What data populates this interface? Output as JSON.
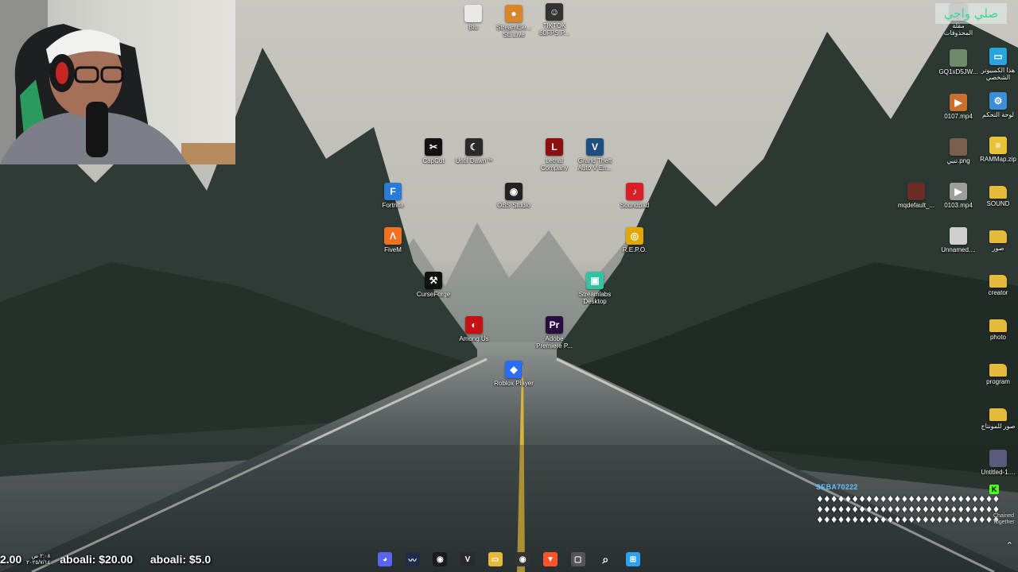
{
  "overlay": {
    "arabic_text": "صلي واجي"
  },
  "chat": {
    "username": "SEBA70222",
    "message": "♦♦♦♦♦♦♦♦♦♦♦♦♦♦♦♦♦♦♦♦♦♦♦♦♦♦♦♦♦♦♦♦♦♦♦♦♦♦♦♦♦♦♦♦♦♦♦♦♦♦♦♦♦♦♦♦♦♦♦♦♦♦♦♦♦♦♦♦♦♦♦♦♦♦♦♦♦♦",
    "badge": "K",
    "side_note": "Chained\nTogether"
  },
  "ticker": {
    "clock_time": "٢:٠٨ ص",
    "clock_date": "٢٠٢٥/٧/١٤",
    "entries": [
      {
        "amount": "2.00",
        "name": "aboali:",
        "value": "$20.00"
      },
      {
        "name": "aboali:",
        "value": "$5.0"
      }
    ]
  },
  "desktop_icons": [
    {
      "id": "blu",
      "label": "Blu",
      "color": "#e8e8e8",
      "glyph": ""
    },
    {
      "id": "streamelements",
      "label": "StreamEle...\nSE.Live",
      "color": "#d9862b",
      "glyph": "●"
    },
    {
      "id": "tiktok",
      "label": "TIKTOK\n60FPS P...",
      "color": "#333",
      "glyph": "☺"
    },
    {
      "id": "capcut",
      "label": "CapCut",
      "color": "#111",
      "glyph": "✂"
    },
    {
      "id": "until-dawn",
      "label": "Until Dawn™",
      "color": "#2a2a2a",
      "glyph": "☾"
    },
    {
      "id": "lethal-company",
      "label": "Lethal\nCompany",
      "color": "#8b1010",
      "glyph": "L"
    },
    {
      "id": "gta",
      "label": "Grand Theft\nAuto V En...",
      "color": "#1d4f80",
      "glyph": "V"
    },
    {
      "id": "fortnite",
      "label": "Fortnite",
      "color": "#2a7ad8",
      "glyph": "F"
    },
    {
      "id": "obs",
      "label": "OBS Studio",
      "color": "#222",
      "glyph": "◉"
    },
    {
      "id": "soundpad",
      "label": "Soundpad",
      "color": "#d91f26",
      "glyph": "♪"
    },
    {
      "id": "fivem",
      "label": "FiveM",
      "color": "#f27121",
      "glyph": "Λ"
    },
    {
      "id": "repo",
      "label": "R.E.P.O.",
      "color": "#e0a800",
      "glyph": "◎"
    },
    {
      "id": "curseforge",
      "label": "CurseForge",
      "color": "#111",
      "glyph": "⚒"
    },
    {
      "id": "streamlabs",
      "label": "Streamlabs\nDesktop",
      "color": "#31c3a2",
      "glyph": "▣"
    },
    {
      "id": "among-us",
      "label": "Among Us",
      "color": "#c51111",
      "glyph": "◐"
    },
    {
      "id": "premiere",
      "label": "Adobe\nPremiere P...",
      "color": "#2a0b3f",
      "glyph": "Pr"
    },
    {
      "id": "roblox",
      "label": "Roblox Player",
      "color": "#2b6df2",
      "glyph": "◆"
    },
    {
      "id": "png-top",
      "label": "مقلة\nالمحذوفات",
      "color": "#9fa3a5",
      "glyph": ""
    },
    {
      "id": "this-pc",
      "label": "هذا الكمبيوتر\nالشخصي",
      "color": "#2aa4e0",
      "glyph": "▭"
    },
    {
      "id": "gq-img",
      "label": "GQ1xD5JW...",
      "color": "#6d8a6a",
      "glyph": ""
    },
    {
      "id": "control-panel",
      "label": "لوحة التحكم",
      "color": "#3b8fd8",
      "glyph": "⚙"
    },
    {
      "id": "mp4-0107",
      "label": "0107.mp4",
      "color": "#c9702f",
      "glyph": "▶"
    },
    {
      "id": "png-2",
      "label": "تنبي.png",
      "color": "#7a5f4c",
      "glyph": ""
    },
    {
      "id": "rammap",
      "label": "RAMMap.zip",
      "color": "#e9c23a",
      "glyph": "≡"
    },
    {
      "id": "mqdefault",
      "label": "mqdefault_...",
      "color": "#6b2c25",
      "glyph": ""
    },
    {
      "id": "mp4-0103",
      "label": "0103.mp4",
      "color": "#9d9d9d",
      "glyph": "▶"
    },
    {
      "id": "sound",
      "label": "SOUND",
      "color": "#e6b93a",
      "glyph": ""
    },
    {
      "id": "unnamed",
      "label": "Unnamed....",
      "color": "#cfcfcf",
      "glyph": ""
    },
    {
      "id": "folder-images",
      "label": "صور",
      "color": "#e6b93a",
      "glyph": ""
    },
    {
      "id": "creator",
      "label": "creator",
      "color": "#e6b93a",
      "glyph": ""
    },
    {
      "id": "photo",
      "label": "photo",
      "color": "#e6b93a",
      "glyph": ""
    },
    {
      "id": "program",
      "label": "program",
      "color": "#e6b93a",
      "glyph": ""
    },
    {
      "id": "montage",
      "label": "صور للمونتاج",
      "color": "#e6b93a",
      "glyph": ""
    },
    {
      "id": "untitled",
      "label": "Untitled-1....",
      "color": "#5a5a7a",
      "glyph": ""
    }
  ],
  "taskbar": [
    {
      "id": "discord",
      "color": "#5865f2",
      "glyph": "◕"
    },
    {
      "id": "streamerbot",
      "color": "#1e2b4a",
      "glyph": "〰"
    },
    {
      "id": "chrome-like",
      "color": "#1a1a1a",
      "glyph": "◉"
    },
    {
      "id": "voicemeeter",
      "color": "#2b2b2b",
      "glyph": "V"
    },
    {
      "id": "file-explorer",
      "color": "#e6b93a",
      "glyph": "▭"
    },
    {
      "id": "obs",
      "color": "#333",
      "glyph": "◉"
    },
    {
      "id": "brave",
      "color": "#fb542b",
      "glyph": "▼"
    },
    {
      "id": "task-view",
      "color": "#555",
      "glyph": "▢"
    },
    {
      "id": "search",
      "color": "transparent",
      "glyph": "⌕"
    },
    {
      "id": "start",
      "color": "#2aa3f0",
      "glyph": "⊞"
    }
  ]
}
